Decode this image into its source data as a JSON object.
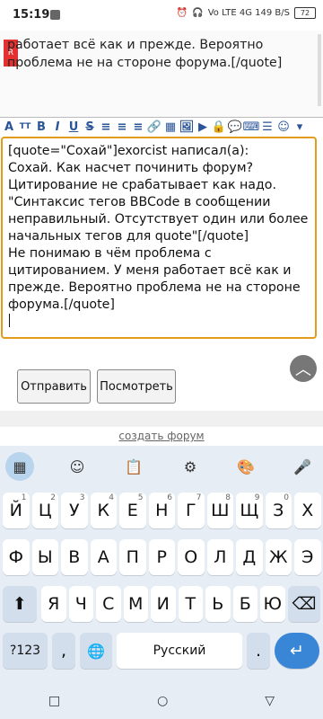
{
  "status": {
    "time": "15:19",
    "right_text": "Vo LTE 4G 149 B/S",
    "battery": "72"
  },
  "top_quote": {
    "text": "работает всё как и прежде. Вероятно проблема не на стороне форума.[/quote]"
  },
  "editor": {
    "text": "[quote=\"Сохай\"]exorcist написал(а):\nСохай. Как насчет починить форум? Цитирование не срабатывает как надо. \"Синтаксис тегов BBCode в сообщении неправильный. Отсутствует один или более начальных тегов для quote\"[/quote]\nНе понимаю в чём проблема с цитированием. У меня работает всё как и прежде. Вероятно проблема не на стороне форума.[/quote]"
  },
  "buttons": {
    "send": "Отправить",
    "preview": "Посмотреть"
  },
  "footer_link": "создать форум",
  "keyboard": {
    "row1": [
      {
        "k": "Й",
        "a": "1"
      },
      {
        "k": "Ц",
        "a": "2"
      },
      {
        "k": "У",
        "a": "3"
      },
      {
        "k": "К",
        "a": "4"
      },
      {
        "k": "Е",
        "a": "5"
      },
      {
        "k": "Н",
        "a": "6"
      },
      {
        "k": "Г",
        "a": "7"
      },
      {
        "k": "Ш",
        "a": "8"
      },
      {
        "k": "Щ",
        "a": "9"
      },
      {
        "k": "З",
        "a": "0"
      },
      {
        "k": "Х",
        "a": ""
      }
    ],
    "row2": [
      "Ф",
      "Ы",
      "В",
      "А",
      "П",
      "Р",
      "О",
      "Л",
      "Д",
      "Ж",
      "Э"
    ],
    "row3": [
      "Я",
      "Ч",
      "С",
      "М",
      "И",
      "Т",
      "Ь",
      "Б",
      "Ю"
    ],
    "sym": "?123",
    "comma": ",",
    "space": "Русский",
    "period": "."
  }
}
